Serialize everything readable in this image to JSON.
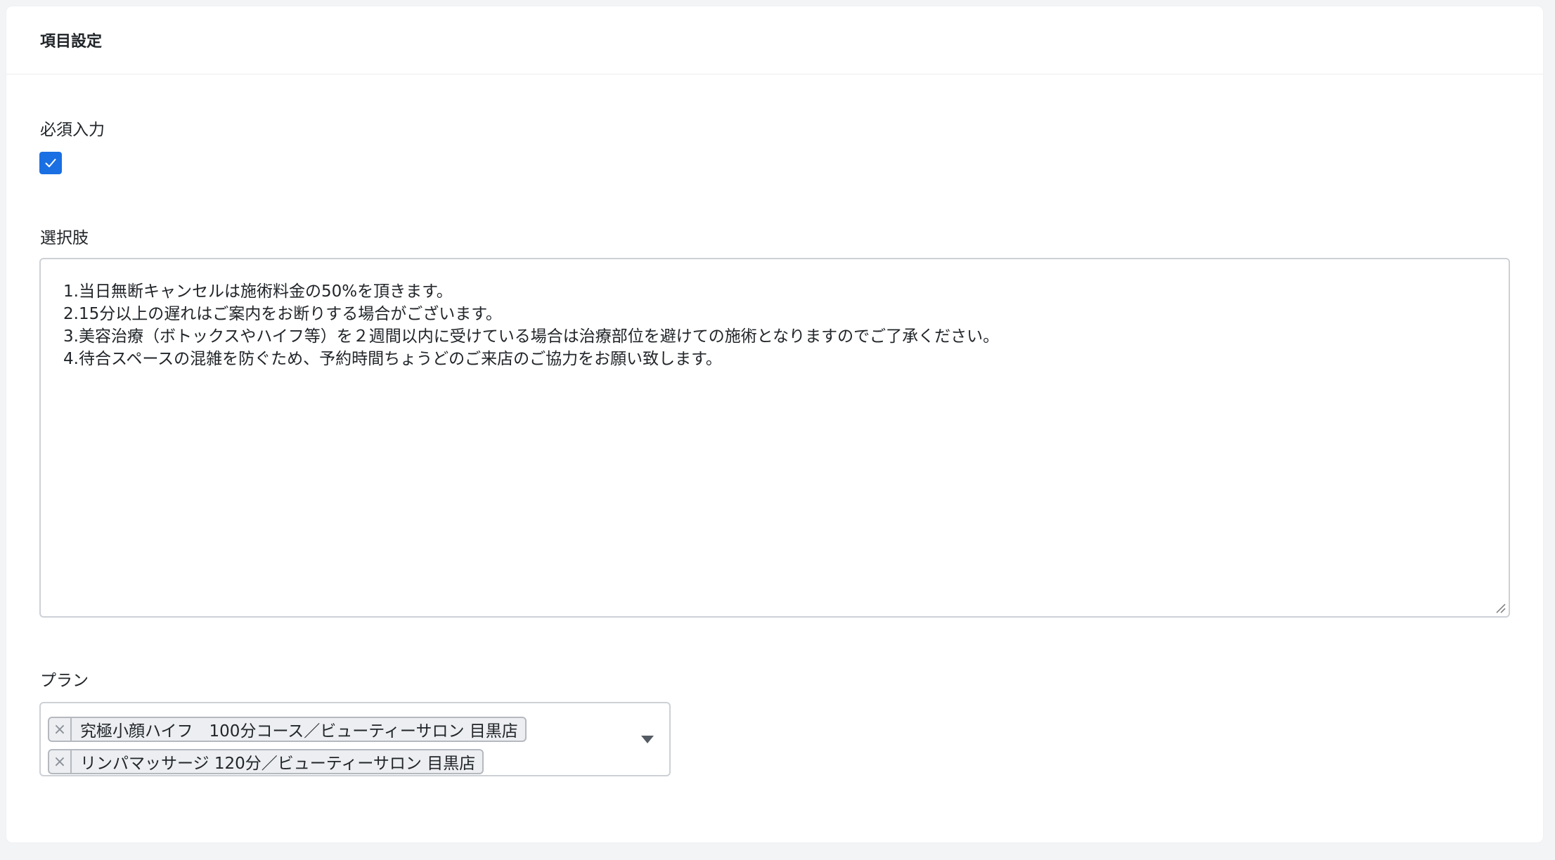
{
  "card": {
    "title": "項目設定"
  },
  "required": {
    "label": "必須入力",
    "checked": true
  },
  "options": {
    "label": "選択肢",
    "value": "1.当日無断キャンセルは施術料金の50%を頂きます。\n2.15分以上の遅れはご案内をお断りする場合がございます。\n3.美容治療（ボトックスやハイフ等）を２週間以内に受けている場合は治療部位を避けての施術となりますのでご了承ください。\n4.待合スペースの混雑を防ぐため、予約時間ちょうどのご来店のご協力をお願い致します。"
  },
  "plan": {
    "label": "プラン",
    "selected": [
      {
        "remove": "×",
        "label": "究極小顔ハイフ　100分コース／ビューティーサロン 目黒店"
      },
      {
        "remove": "×",
        "label": "リンパマッサージ 120分／ビューティーサロン 目黒店"
      }
    ]
  },
  "colors": {
    "accent": "#1a6fe3",
    "border": "#cdd1d6",
    "tag_bg": "#eceef1"
  },
  "icons": {
    "checkbox": "check-icon",
    "tag_remove": "close-icon",
    "dropdown": "chevron-down-icon",
    "resize": "resize-handle-icon"
  }
}
